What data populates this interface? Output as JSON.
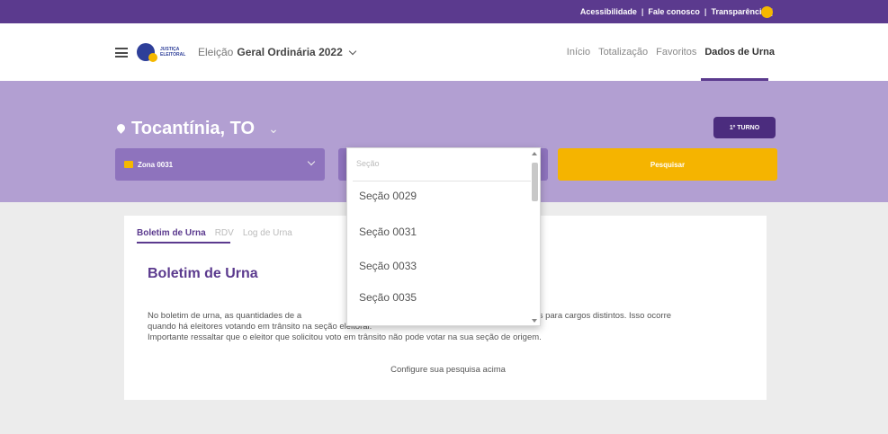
{
  "topbar": {
    "links": [
      "Acessibilidade",
      "Fale conosco",
      "Transparência"
    ],
    "separator": "|",
    "accent_color": "#5b3a8e"
  },
  "header": {
    "logo_text_line1": "JUSTIÇA",
    "logo_text_line2": "ELEITORAL",
    "election_prefix": "Eleição",
    "election_name": "Geral Ordinária 2022",
    "nav": [
      "Início",
      "Totalização",
      "Favoritos",
      "Dados de Urna"
    ]
  },
  "banner": {
    "location": "Tocantínia, TO",
    "turno_button": "1º TURNO",
    "zona_label": "Zona 0031",
    "pesquisar_label": "Pesquisar"
  },
  "dropdown": {
    "search_placeholder": "Seção",
    "options": [
      "Seção 0029",
      "Seção 0031",
      "Seção 0033",
      "Seção 0035"
    ],
    "highlighted_index": 0
  },
  "card": {
    "tabs": [
      "Boletim de Urna",
      "RDV",
      "Log de Urna"
    ],
    "active_tab": "Boletim de Urna",
    "title": "Boletim de Urna",
    "paragraph_line1_start": "No boletim de urna, as quantidades de a",
    "paragraph_line1_end": "ferentes para cargos distintos. Isso ocorre",
    "paragraph_line2": "quando há eleitores votando em trânsito na seção eleitoral.",
    "paragraph_line3": "Importante ressaltar que o eleitor que solicitou voto em trânsito não pode votar na sua seção de origem.",
    "configure": "Configure sua pesquisa acima"
  },
  "colors": {
    "purple_dark": "#5b3a8e",
    "purple_banner": "#b29fd2",
    "purple_select": "#8e73bd",
    "yellow": "#f5b400"
  }
}
